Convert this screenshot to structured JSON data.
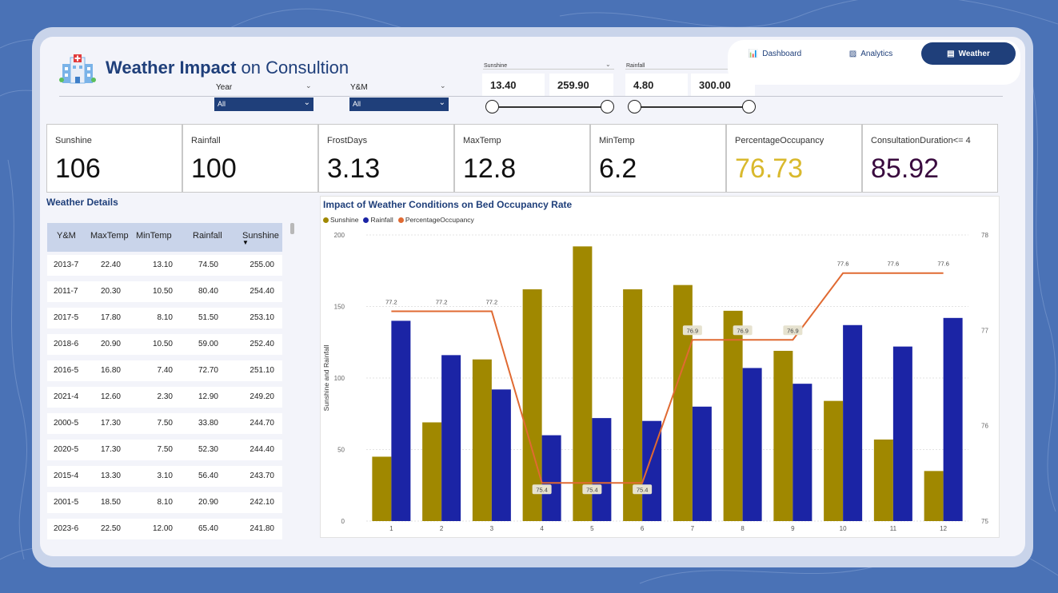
{
  "header": {
    "title_bold": "Weather Impact",
    "title_rest": " on Consultion"
  },
  "filters": {
    "year_label": "Year",
    "year_value": "All",
    "ym_label": "Y&M",
    "ym_value": "All",
    "sunshine_label": "Sunshine",
    "sunshine_min": "13.40",
    "sunshine_max": "259.90",
    "rainfall_label": "Rainfall",
    "rainfall_min": "4.80",
    "rainfall_max": "300.00"
  },
  "nav": {
    "dashboard": "Dashboard",
    "analytics": "Analytics",
    "weather": "Weather"
  },
  "kpis": [
    {
      "label": "Sunshine",
      "value": "106",
      "color": "#111111"
    },
    {
      "label": "Rainfall",
      "value": "100",
      "color": "#111111"
    },
    {
      "label": "FrostDays",
      "value": "3.13",
      "color": "#111111"
    },
    {
      "label": "MaxTemp",
      "value": "12.8",
      "color": "#111111"
    },
    {
      "label": "MinTemp",
      "value": "6.2",
      "color": "#111111"
    },
    {
      "label": "PercentageOccupancy",
      "value": "76.73",
      "color": "#d9b92d"
    },
    {
      "label": "ConsultationDuration<= 4",
      "value": "85.92",
      "color": "#3a0b3f"
    }
  ],
  "weather_table": {
    "title": "Weather Details",
    "columns": [
      "Y&M",
      "MaxTemp",
      "MinTemp",
      "Rainfall",
      "Sunshine"
    ],
    "sort_indicator": "▼",
    "rows": [
      [
        "2013-7",
        "22.40",
        "13.10",
        "74.50",
        "255.00"
      ],
      [
        "2011-7",
        "20.30",
        "10.50",
        "80.40",
        "254.40"
      ],
      [
        "2017-5",
        "17.80",
        "8.10",
        "51.50",
        "253.10"
      ],
      [
        "2018-6",
        "20.90",
        "10.50",
        "59.00",
        "252.40"
      ],
      [
        "2016-5",
        "16.80",
        "7.40",
        "72.70",
        "251.10"
      ],
      [
        "2021-4",
        "12.60",
        "2.30",
        "12.90",
        "249.20"
      ],
      [
        "2000-5",
        "17.30",
        "7.50",
        "33.80",
        "244.70"
      ],
      [
        "2020-5",
        "17.30",
        "7.50",
        "52.30",
        "244.40"
      ],
      [
        "2015-4",
        "13.30",
        "3.10",
        "56.40",
        "243.70"
      ],
      [
        "2001-5",
        "18.50",
        "8.10",
        "20.90",
        "242.10"
      ],
      [
        "2023-6",
        "22.50",
        "12.00",
        "65.40",
        "241.80"
      ]
    ]
  },
  "chart_data": {
    "type": "bar",
    "title": "Impact of Weather Conditions on Bed Occupancy Rate",
    "ylabel": "Sunshine and Rainfall",
    "categories": [
      "1",
      "2",
      "3",
      "4",
      "5",
      "6",
      "7",
      "8",
      "9",
      "10",
      "11",
      "12"
    ],
    "ylim": [
      0,
      200
    ],
    "yticks": [
      "0",
      "50",
      "100",
      "150",
      "200"
    ],
    "y2lim": [
      75,
      78
    ],
    "y2ticks": [
      "75",
      "76",
      "77",
      "78"
    ],
    "legend_position": "top-left",
    "grid": true,
    "series": [
      {
        "name": "Sunshine",
        "type": "bar",
        "color": "#a08800",
        "values": [
          45,
          69,
          113,
          162,
          192,
          162,
          165,
          147,
          119,
          84,
          57,
          35
        ]
      },
      {
        "name": "Rainfall",
        "type": "bar",
        "color": "#1b24a5",
        "values": [
          140,
          116,
          92,
          60,
          72,
          70,
          80,
          107,
          96,
          137,
          122,
          142
        ]
      },
      {
        "name": "PercentageOccupancy",
        "type": "line",
        "axis": "secondary",
        "color": "#e06a32",
        "values": [
          77.2,
          77.2,
          77.2,
          75.4,
          75.4,
          75.4,
          76.9,
          76.9,
          76.9,
          77.6,
          77.6,
          77.6
        ],
        "labels": [
          "77.2",
          "77.2",
          "77.2",
          "75.4",
          "75.4",
          "75.4",
          "76.9",
          "76.9",
          "76.9",
          "77.6",
          "77.6",
          "77.6"
        ]
      }
    ]
  }
}
